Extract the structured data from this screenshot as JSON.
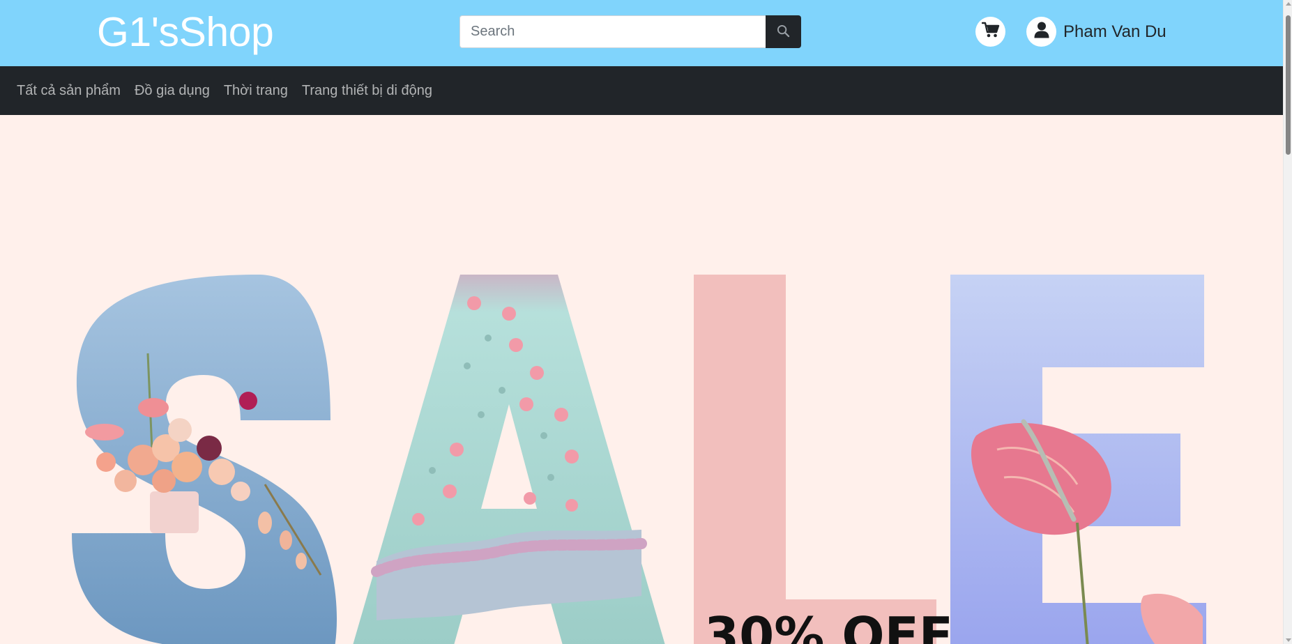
{
  "header": {
    "brand": "G1'sShop",
    "search": {
      "placeholder": "Search",
      "value": "",
      "button_icon": "search-icon"
    },
    "cart_icon": "cart-icon",
    "user": {
      "avatar_icon": "user-icon",
      "name": "Pham Van Du"
    }
  },
  "nav": {
    "items": [
      {
        "label": "Tất cả sản phẩm"
      },
      {
        "label": "Đồ gia dụng"
      },
      {
        "label": "Thời trang"
      },
      {
        "label": "Trang thiết bị di động"
      }
    ]
  },
  "banner": {
    "word": "SALE",
    "offer": "30% OFF"
  },
  "colors": {
    "header_bg": "#80d4fc",
    "nav_bg": "#212529",
    "banner_bg": "#fff0eb",
    "letter_s": "#7fa7cb",
    "letter_a": "#a8d6d0",
    "letter_l": "#f2bfbd",
    "letter_e": "#a9b1f2"
  }
}
